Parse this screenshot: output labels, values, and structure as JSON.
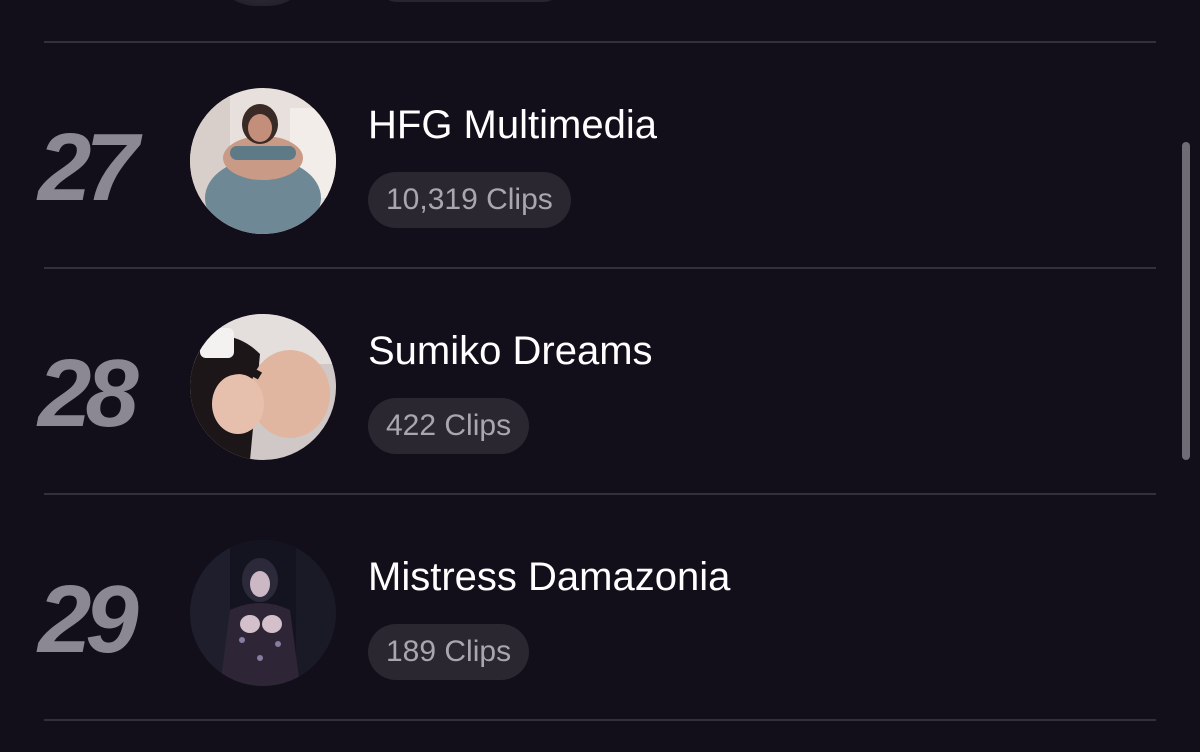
{
  "creators": [
    {
      "rank": "27",
      "name": "HFG Multimedia",
      "clips": "10,319 Clips"
    },
    {
      "rank": "28",
      "name": "Sumiko Dreams",
      "clips": "422 Clips"
    },
    {
      "rank": "29",
      "name": "Mistress Damazonia",
      "clips": "189 Clips"
    }
  ],
  "colors": {
    "background": "#120e1a",
    "rank_text": "#8b8893",
    "badge_bg": "#2b2731",
    "badge_text": "#a9a6ae",
    "divider": "#34303b"
  }
}
